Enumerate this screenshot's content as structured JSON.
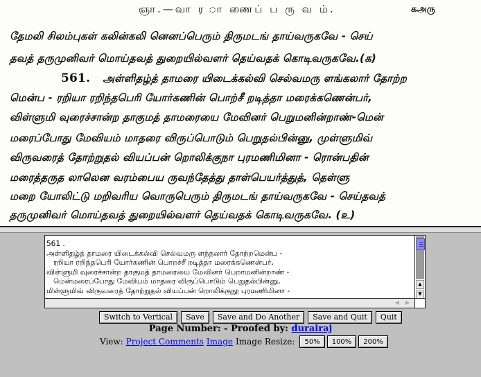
{
  "scan": {
    "header": "ஞா.—வா ர ா ணைப் ப ரு வ ம்.",
    "page_number": "கஅரு",
    "verse_number": "561.",
    "lines": [
      "தேமலி சிலம்புகள் கலின்கலி னெனப்பெரும் திருமடங் தாய்வருகவே - செய்",
      "தவத் தருமுனிவர் மொய்தவத் துறையில்வளர் தெய்வதக் கொடிவருகவே.(க)",
      "அள்ளிதழ்த் தாமரை யிடைக்கல்வி செல்வமரு ளங்கலார் தோற்ற",
      "மென்ப - ரறியா ரறிந்தபெரி யோர்கணின் பொற்சீ றடித்தா மரைக்கணென்பர்,",
      "விள்ளுமி வுரைச்சான்ற தாகுமத் தாமரையை மேவினர் பெறுமனின்றாண்-மென்",
      "மரைப்போது மேவியம் மாதரை விருப்பொடும் பெறுதல்பின்னு, முள்ளுமிவ்",
      "விருவரைத் தோற்றுதல் வியப்பன் றொலிக்குநா புரமணிமினா - ரொன்பதின்",
      "மரைத்தருத லாலென வரம்பைய ருவந்தேத்து தாள்பெயர்த்துத், தெள்ளு",
      "மறை யோலிட்டு மறிவரிய வொருபெரும் திருமடங் தாய்வருகவே - செய்தவத்",
      "தருமுனிவர் மொய்தவத் துறையில்வளர் தெய்வதக் கொடிவருகவே.     (உ)"
    ]
  },
  "editor": {
    "text": "561 .\nஅள்ளிதழ்த் தாமரை யிடைக்கல்வி செல்வமரு ளந்நலார் தோற்றமென்ப -\n   ரறியா ரறிந்தபெரி யோர்கணின் பொறச்சீ றடித்தா மரைக்கணென்பர்,\nவிள்ளுமி வுரைச்சான்ற தாகுமத் தாமரையை மேவினர் பெறாமனின்றாண் -\n   மென்மரைப்போது மேவியம் மாதரை விருப்பொடும் பெறுதல்பின்னு,\nமிள்ளுமிவ் விருவரைத் தோற்றுதல் வியப்பன் றொலிக்குநூ புரமணிமினா -"
  },
  "toolbar": {
    "switch_label": "Switch to Vertical",
    "save_label": "Save",
    "save_another_label": "Save and Do Another",
    "save_quit_label": "Save and Quit",
    "quit_label": "Quit"
  },
  "info": {
    "page_number_label": "Page Number: - Proofed by:",
    "proofer": "durairaj",
    "view_label": "View:",
    "project_comments_link": "Project Comments",
    "image_link": "Image",
    "resize_label": "Image Resize:",
    "resize_options": [
      "50%",
      "100%",
      "200%"
    ]
  }
}
